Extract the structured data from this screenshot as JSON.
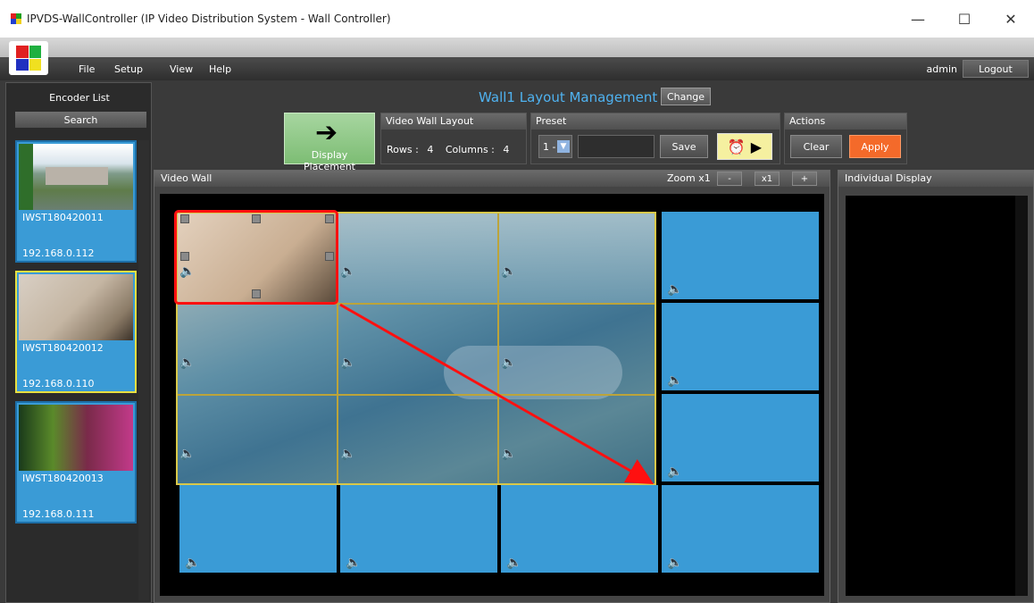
{
  "window": {
    "title": "IPVDS-WallController (IP Video Distribution System - Wall Controller)",
    "minimize": "—",
    "maximize": "☐",
    "close": "✕"
  },
  "menu": {
    "file": "File",
    "setup": "Setup",
    "view": "View",
    "help": "Help",
    "user": "admin",
    "logout": "Logout"
  },
  "left": {
    "title": "Encoder List",
    "search": "Search",
    "encoders": [
      {
        "name": "IWST180420011",
        "ip": "192.168.0.112"
      },
      {
        "name": "IWST180420012",
        "ip": "192.168.0.110"
      },
      {
        "name": "IWST180420013",
        "ip": "192.168.0.111"
      }
    ]
  },
  "header": {
    "title": "Wall1 Layout Management",
    "change": "Change"
  },
  "controls": {
    "display_placement": "Display Placement",
    "layout_head": "Video Wall Layout",
    "rows_label": "Rows :",
    "rows_value": "4",
    "cols_label": "Columns :",
    "cols_value": "4",
    "preset_head": "Preset",
    "preset_value": "1 -",
    "save": "Save",
    "actions_head": "Actions",
    "clear": "Clear",
    "apply": "Apply"
  },
  "wall": {
    "title": "Video Wall",
    "zoom_label": "Zoom x1",
    "zoom_minus": "-",
    "zoom_reset": "x1",
    "zoom_plus": "+"
  },
  "individual": {
    "title": "Individual Display"
  },
  "colors": {
    "accent_blue": "#3a9bd6",
    "apply_orange": "#f46a2a",
    "title_blue": "#4fb2f0",
    "selection_red": "#ff1010"
  }
}
